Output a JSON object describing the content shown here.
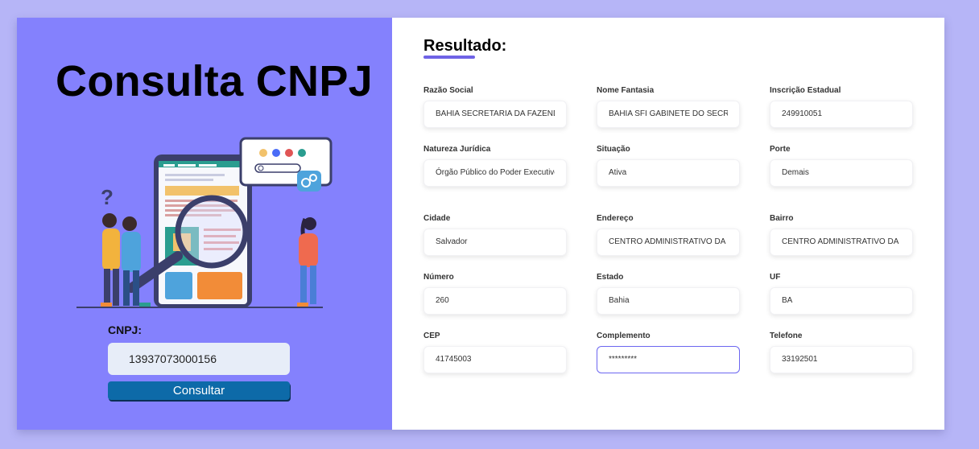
{
  "left_panel": {
    "title": "Consulta CNPJ",
    "cnpj_label": "CNPJ:",
    "cnpj_value": "13937073000156",
    "consult_button": "Consultar"
  },
  "result": {
    "title": "Resultado:",
    "fields": [
      {
        "label": "Razão Social",
        "value": "BAHIA SECRETARIA DA FAZENDA"
      },
      {
        "label": "Nome Fantasia",
        "value": "BAHIA SFI GABINETE DO SECRETARIO"
      },
      {
        "label": "Inscrição Estadual",
        "value": "249910051"
      },
      {
        "label": "Natureza Jurídica",
        "value": "Órgão Público do Poder Executivo Estadual"
      },
      {
        "label": "Situação",
        "value": "Ativa"
      },
      {
        "label": "Porte",
        "value": "Demais"
      },
      {
        "label": "Cidade",
        "value": "Salvador"
      },
      {
        "label": "Endereço",
        "value": "CENTRO ADMINISTRATIVO DA BAHIA"
      },
      {
        "label": "Bairro",
        "value": "CENTRO ADMINISTRATIVO DA BAHIA"
      },
      {
        "label": "Número",
        "value": "260"
      },
      {
        "label": "Estado",
        "value": "Bahia"
      },
      {
        "label": "UF",
        "value": "BA"
      },
      {
        "label": "CEP",
        "value": "41745003"
      },
      {
        "label": "Complemento",
        "value": "*********"
      },
      {
        "label": "Telefone",
        "value": "33192501"
      }
    ]
  },
  "colors": {
    "page_bg": "#b6b5f7",
    "left_panel_bg": "#8481fd",
    "accent": "#6f63e6",
    "button_bg": "#0d6aa8"
  }
}
